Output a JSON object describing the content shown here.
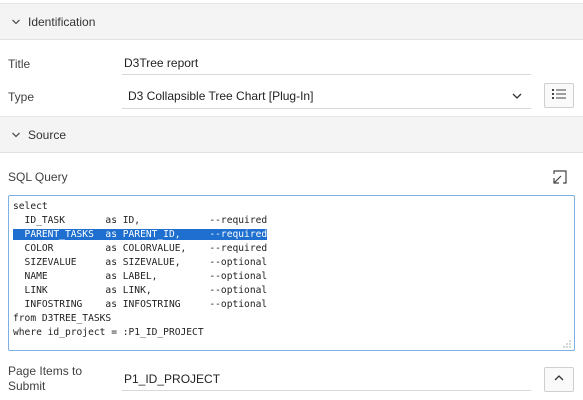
{
  "sections": {
    "identification": {
      "title": "Identification"
    },
    "source": {
      "title": "Source"
    }
  },
  "identification": {
    "title_label": "Title",
    "title_value": "D3Tree report",
    "type_label": "Type",
    "type_value": "D3 Collapsible Tree Chart [Plug-In]"
  },
  "source": {
    "sql_label": "SQL Query",
    "sql_lines": [
      "select",
      "  ID_TASK       as ID,            --required",
      "  PARENT_TASKS  as PARENT_ID,     --required",
      "  COLOR         as COLORVALUE,    --required",
      "  SIZEVALUE     as SIZEVALUE,     --optional",
      "  NAME          as LABEL,         --optional",
      "  LINK          as LINK,          --optional",
      "  INFOSTRING    as INFOSTRING     --optional",
      "from D3TREE_TASKS",
      "where id_project = :P1_ID_PROJECT"
    ],
    "page_items_label_line1": "Page Items to",
    "page_items_label_line2": "Submit",
    "page_items_value": "P1_ID_PROJECT"
  },
  "icons": {
    "section_toggle": "chevron-down-icon",
    "type_dropdown": "chevron-down-icon",
    "type_list": "list-icon",
    "expand_editor": "expand-icon",
    "page_items_collapse": "chevron-up-icon"
  },
  "colors": {
    "selection": "#1e6fcf",
    "editor_border": "#7fb1e0",
    "section_bg": "#f4f4f4"
  }
}
